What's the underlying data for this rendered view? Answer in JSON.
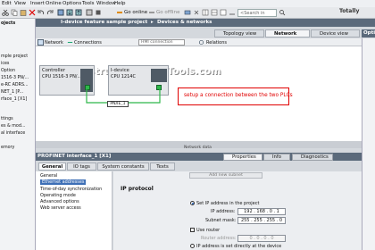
{
  "menu": [
    "Edit",
    "View",
    "Insert",
    "Online",
    "Options",
    "Tools",
    "Window",
    "Help"
  ],
  "toolbar": {
    "go_online": "Go online",
    "go_offline": "Go offline",
    "search_placeholder": "<Search in project>",
    "totally": "Totally"
  },
  "left_tree": [
    "ojects",
    "mple project",
    "ices",
    "Option",
    "1516-3 PN/...",
    "e-RC ADRS...",
    "NET_1 [P...",
    "rface_1 [X1]",
    "",
    "",
    "ttings",
    "es & mod...",
    "al interface",
    "",
    "emory"
  ],
  "title": {
    "project": "I-device feature sample project",
    "sep": "▸",
    "section": "Devices & networks"
  },
  "view_tabs": {
    "topology": "Topology view",
    "network": "Network view",
    "device": "Device view"
  },
  "right_tab": "Opti",
  "net_toolbar": {
    "network": "Network",
    "connections": "Connections",
    "hmi": "HMI connection",
    "relations": "Relations"
  },
  "watermark": "InstrumentationTools.com",
  "devices": [
    {
      "name": "Controller",
      "cpu": "CPU 1516-3 PN/..."
    },
    {
      "name": "I-device",
      "cpu": "CPU 1214C"
    }
  ],
  "pn_label": "PN/IE_1",
  "annotation": "setup a connection between the two PLCs",
  "network_data": "Network data",
  "prop_header": {
    "title": "PROFINET interface_1 [X1]",
    "properties": "Properties",
    "info": "Info",
    "diagnostics": "Diagnostics"
  },
  "general_tabs": [
    "General",
    "IO tags",
    "System constants",
    "Texts"
  ],
  "nav_items": [
    "General",
    "Ethernet addresses",
    "Time-of-day synchronization",
    "Operating mode",
    "Advanced options",
    "Web server access"
  ],
  "props": {
    "add_subnet": "Add new subnet",
    "ip_protocol": "IP protocol",
    "set_ip": "Set IP address in the project",
    "ip_label": "IP address:",
    "ip_value": "192 . 168 . 0 . 1",
    "mask_label": "Subnet mask:",
    "mask_value": "255 . 255 . 255 . 0",
    "use_router": "Use router",
    "router_label": "Router address:",
    "router_value": "0 . 0 . 0 . 0",
    "ip_other": "IP address is set directly at the device"
  }
}
